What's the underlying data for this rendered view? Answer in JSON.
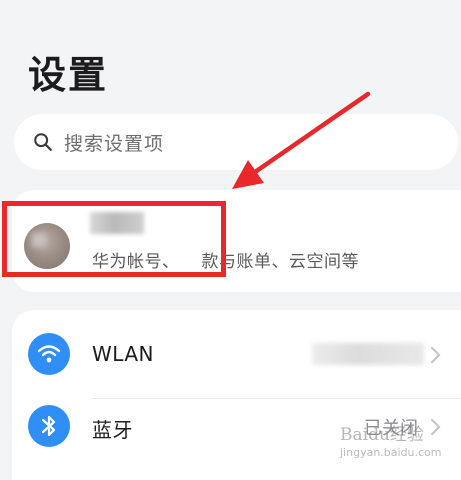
{
  "page": {
    "title": "设置"
  },
  "search": {
    "placeholder": "搜索设置项",
    "icon": "search-icon"
  },
  "account": {
    "subtitle_part1": "华为帐号、",
    "subtitle_part2": "款与账单、云空间等"
  },
  "settings": [
    {
      "label": "WLAN",
      "icon": "wifi-icon",
      "icon_color": "#2f8ff7"
    },
    {
      "label": "蓝牙",
      "icon": "bluetooth-icon",
      "icon_color": "#2f8ff7",
      "value": "已关闭"
    }
  ],
  "annotation": {
    "color": "#e8282b"
  },
  "watermark": {
    "brand": "Baidu经验",
    "url": "jingyan.baidu.com"
  }
}
